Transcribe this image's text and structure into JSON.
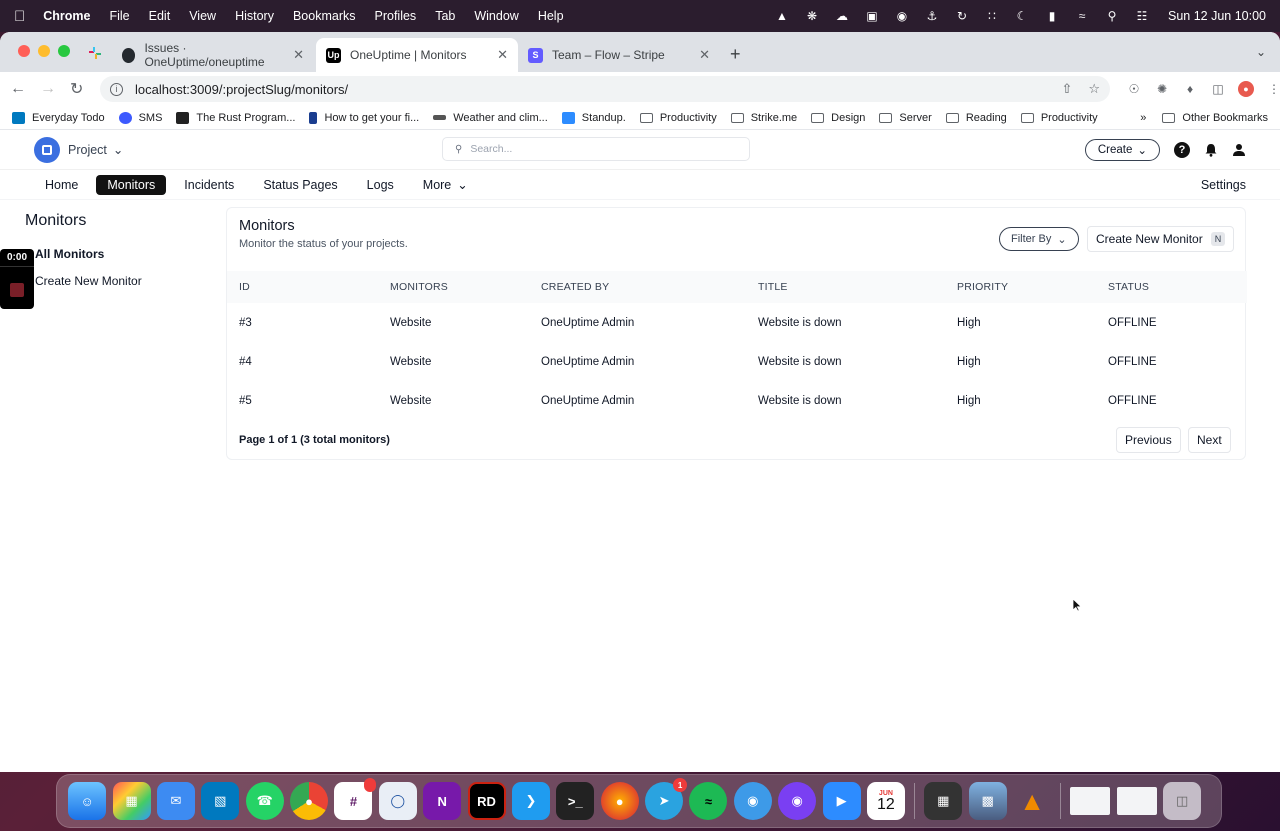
{
  "menubar": {
    "items": [
      "Chrome",
      "File",
      "Edit",
      "View",
      "History",
      "Bookmarks",
      "Profiles",
      "Tab",
      "Window",
      "Help"
    ],
    "clock": "Sun 12 Jun  10:00"
  },
  "browser": {
    "tabs": [
      {
        "title": "Issues · OneUptime/oneuptime",
        "favicon": "github-icon"
      },
      {
        "title": "OneUptime | Monitors",
        "favicon": "oneuptime-icon"
      },
      {
        "title": "Team – Flow – Stripe",
        "favicon": "stripe-icon"
      }
    ],
    "url": "localhost:3009/:projectSlug/monitors/",
    "bookmarks": [
      "Everyday Todo",
      "SMS",
      "The Rust Program...",
      "How to get your fi...",
      "Weather and clim...",
      "Standup.",
      "Productivity",
      "Strike.me",
      "Design",
      "Server",
      "Reading",
      "Productivity"
    ],
    "other_bookmarks": "Other Bookmarks"
  },
  "header": {
    "project": "Project",
    "search_placeholder": "Search...",
    "create": "Create"
  },
  "nav": {
    "items": [
      "Home",
      "Monitors",
      "Incidents",
      "Status Pages",
      "Logs"
    ],
    "more": "More",
    "settings": "Settings",
    "active": "Monitors"
  },
  "sidebar": {
    "title": "Monitors",
    "items": [
      "All Monitors",
      "Create New Monitor"
    ]
  },
  "recorder": {
    "time": "0:00"
  },
  "card": {
    "title": "Monitors",
    "subtitle": "Monitor the status of your projects.",
    "filter": "Filter By",
    "create_new": "Create New Monitor",
    "create_shortcut": "N",
    "columns": [
      "ID",
      "MONITORS",
      "CREATED BY",
      "TITLE",
      "PRIORITY",
      "STATUS"
    ],
    "rows": [
      [
        "#3",
        "Website",
        "OneUptime Admin",
        "Website is down",
        "High",
        "OFFLINE"
      ],
      [
        "#4",
        "Website",
        "OneUptime Admin",
        "Website is down",
        "High",
        "OFFLINE"
      ],
      [
        "#5",
        "Website",
        "OneUptime Admin",
        "Website is down",
        "High",
        "OFFLINE"
      ]
    ],
    "pagination": "Page 1 of 1 (3 total monitors)",
    "previous": "Previous",
    "next": "Next"
  },
  "dock": {
    "badges": {
      "slack": "",
      "telegram": "1"
    },
    "calendar_month": "JUN",
    "calendar_day": "12"
  }
}
